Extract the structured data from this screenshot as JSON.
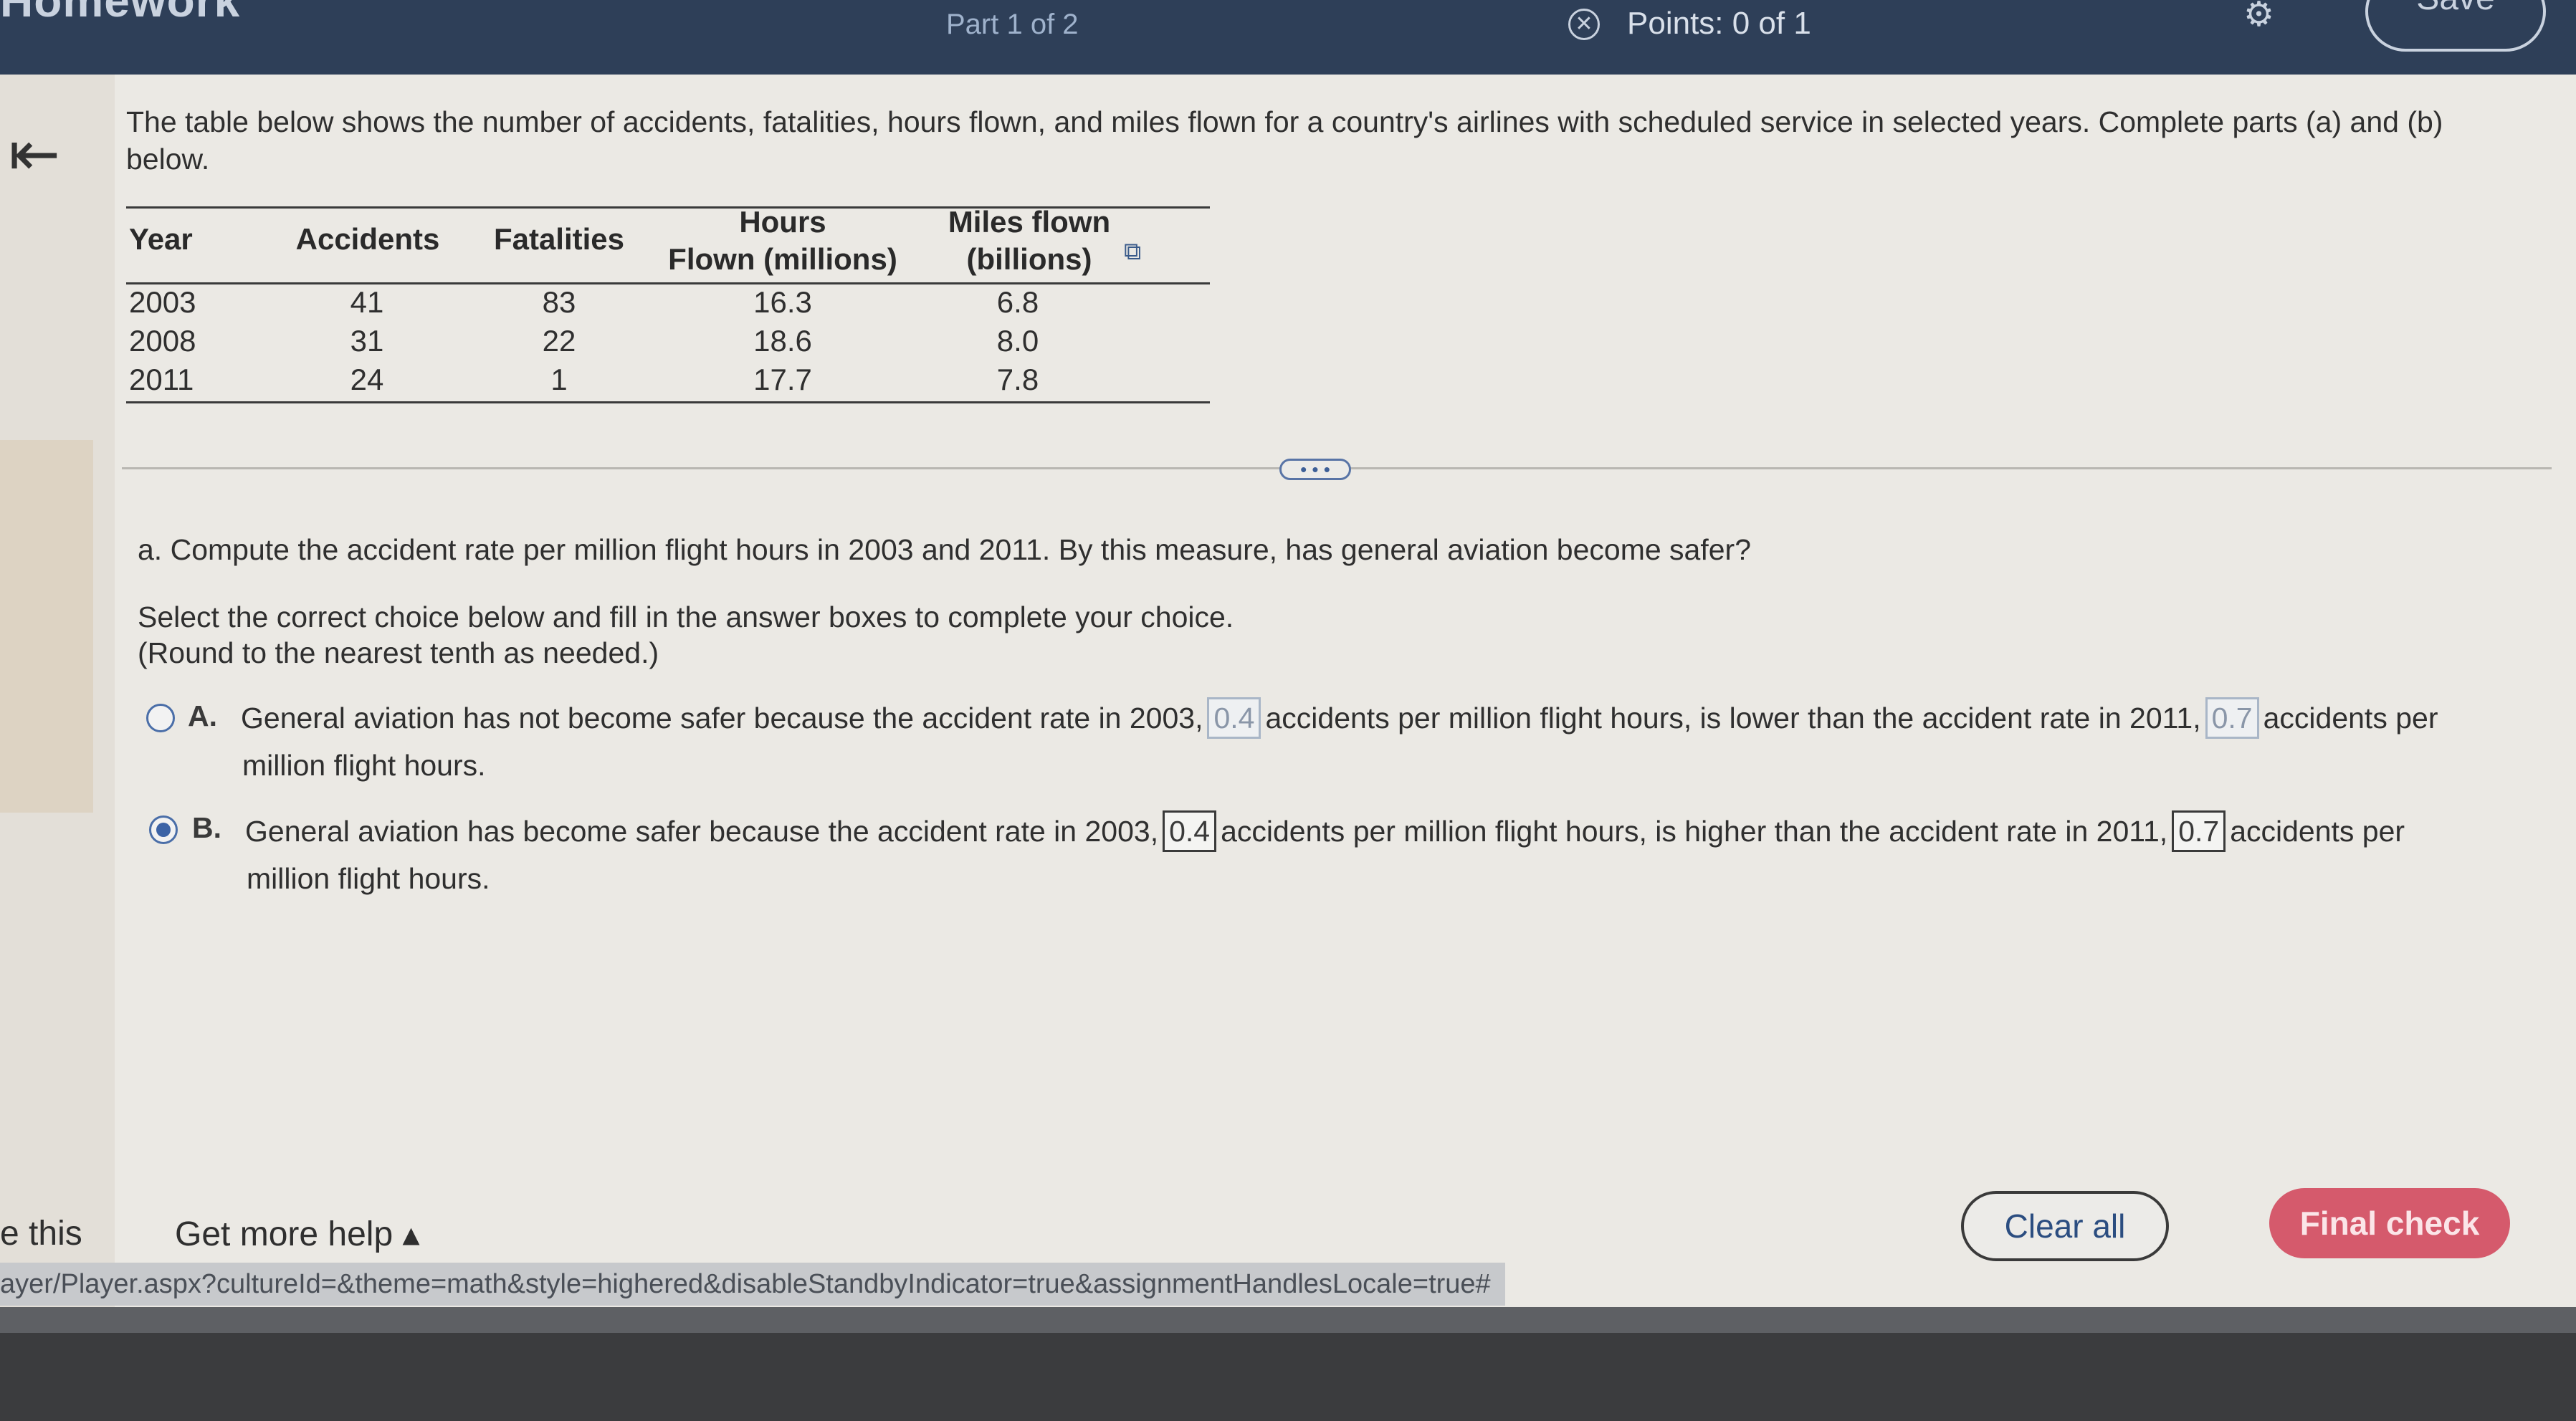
{
  "header": {
    "app_title": "Homework",
    "part": "Part 1 of 2",
    "points": "Points: 0 of 1",
    "save_label": "Save",
    "icons": [
      "points-status-icon",
      "settings-icon"
    ]
  },
  "problem": {
    "intro": "The table below shows the number of accidents, fatalities, hours flown, and miles flown for a country's airlines with scheduled service in selected years. Complete parts (a) and (b) below.",
    "table": {
      "headers": [
        "Year",
        "Accidents",
        "Fatalities",
        "Hours Flown (millions)",
        "Miles flown (billions)"
      ],
      "header_lines": {
        "hours": [
          "Hours",
          "Flown (millions)"
        ],
        "miles": [
          "Miles flown",
          "(billions)"
        ]
      },
      "rows": [
        [
          "2003",
          "41",
          "83",
          "16.3",
          "6.8"
        ],
        [
          "2008",
          "31",
          "22",
          "18.6",
          "8.0"
        ],
        [
          "2011",
          "24",
          "1",
          "17.7",
          "7.8"
        ]
      ]
    },
    "more_label": "• • •",
    "question_a": "a. Compute the accident rate per million flight hours in 2003 and 2011. By this measure, has general aviation become safer?",
    "instruction": "Select the correct choice below and fill in the answer boxes to complete your choice.",
    "round_note": "(Round to the nearest tenth as needed.)",
    "choices": [
      {
        "letter": "A.",
        "selected": false,
        "text_1": "General aviation has not become safer because the accident rate in 2003,",
        "box_1": "0.4",
        "text_2": "accidents per million flight hours, is lower than the accident rate in 2011,",
        "box_2": "0.7",
        "text_3": "accidents per",
        "text_4": "million flight hours."
      },
      {
        "letter": "B.",
        "selected": true,
        "text_1": "General aviation has become safer because the accident rate in 2003,",
        "box_1": "0.4",
        "text_2": "accidents per million flight hours, is higher than the accident rate in 2011,",
        "box_2": "0.7",
        "text_3": "accidents per",
        "text_4": "million flight hours."
      }
    ]
  },
  "footer": {
    "left_partial": "e this",
    "help": "Get more help ▴",
    "clear_all": "Clear all",
    "final_check": "Final check",
    "status_url": "ayer/Player.aspx?cultureId=&theme=math&style=highered&disableStandbyIndicator=true&assignmentHandlesLocale=true#"
  },
  "colors": {
    "header_bg": "#2e3f58",
    "accent_blue": "#3c63a6",
    "final_check_bg": "#d55a6c"
  }
}
